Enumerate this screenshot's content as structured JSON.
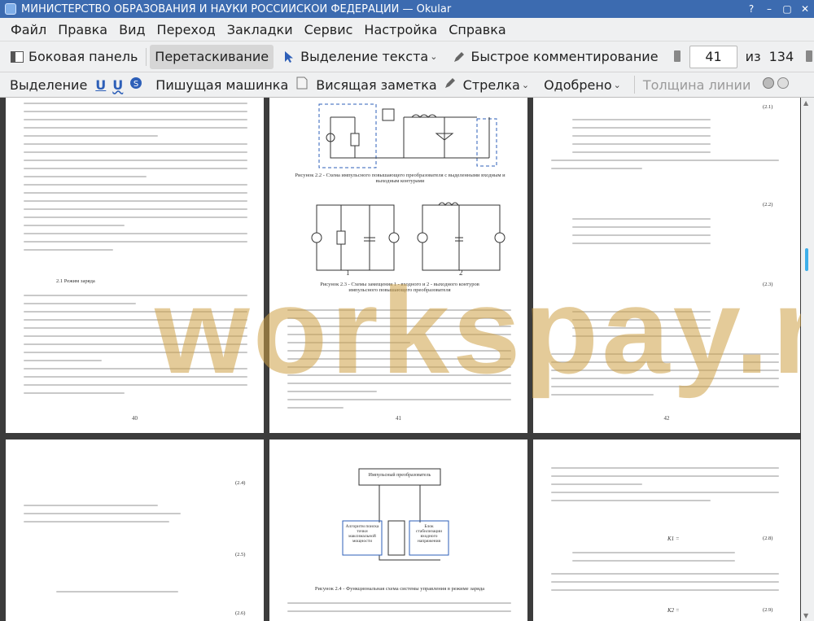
{
  "window": {
    "title": "МИНИСТЕРСТВО ОБРАЗОВАНИЯ И НАУКИ РОССИЙСКОЙ ФЕДЕРАЦИИ  — Okular"
  },
  "menu": [
    "Файл",
    "Правка",
    "Вид",
    "Переход",
    "Закладки",
    "Сервис",
    "Настройка",
    "Справка"
  ],
  "toolbar1": {
    "sidebar": "Боковая панель",
    "drag": "Перетаскивание",
    "text_select": "Выделение текста",
    "quick_comment": "Быстрое комментирование",
    "page_current": "41",
    "page_of": "из",
    "page_total": "134"
  },
  "toolbar2": {
    "highlight": "Выделение",
    "typewriter": "Пишущая машинка",
    "sticky_note": "Висящая заметка",
    "arrow": "Стрелка",
    "stamp": "Одобрено",
    "line_width": "Толщина линии"
  },
  "watermark": "workspay.ru",
  "pages": {
    "p40": {
      "number": "40",
      "heading": "2.1 Режим заряда"
    },
    "p41": {
      "number": "41",
      "caption1": "Рисунок 2.2 - Схема импульсного повышающего преобразователя с выделенными входным и выходным контурами",
      "caption2": "Рисунок 2.3 - Схемы замещения 1 - входного и 2 - выходного контуров импульсного повышающего преобразователя",
      "label1": "1",
      "label2": "2"
    },
    "p42": {
      "number": "42",
      "eq1": "(2.1)",
      "eq2": "(2.2)",
      "eq3": "(2.3)"
    },
    "p43": {
      "eq4": "(2.4)",
      "eq5": "(2.5)",
      "eq6": "(2.6)"
    },
    "p44": {
      "block_top": "Импульсный преобразователь",
      "block1": "Алгоритм поиска точки максимальной мощности",
      "block2": "Блок стабилизации входного напряжения",
      "caption": "Рисунок 2.4 - Функциональная схема системы управления в режиме заряда"
    },
    "p45": {
      "eq8": "(2.8)",
      "eq9": "(2.9)",
      "k1": "K1 =",
      "k2": "K2 ="
    }
  }
}
